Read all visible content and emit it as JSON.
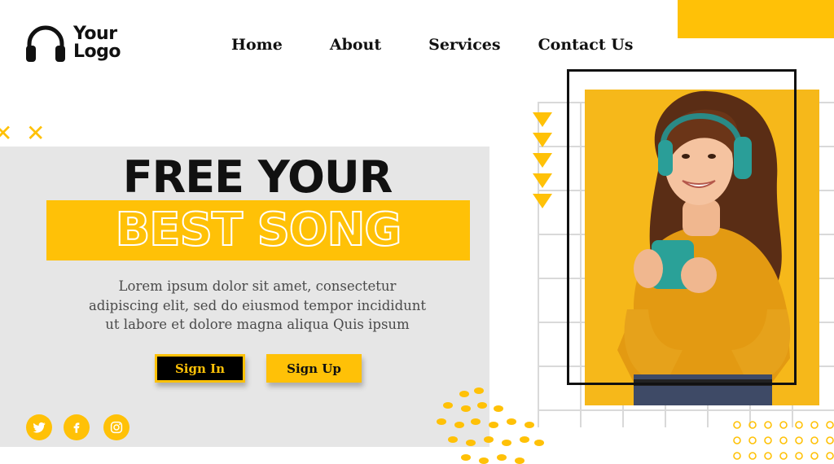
{
  "logo": {
    "line1": "Your",
    "line2": "Logo",
    "icon": "headphones-icon"
  },
  "nav": [
    {
      "label": "Home"
    },
    {
      "label": "About"
    },
    {
      "label": "Services"
    },
    {
      "label": "Contact Us"
    }
  ],
  "hero": {
    "headline_top": "FREE YOUR",
    "headline_bottom": "BEST SONG",
    "description_lines": [
      "Lorem ipsum dolor sit amet, consectetur",
      "adipiscing elit, sed do eiusmod tempor incididunt",
      "ut labore et dolore magna aliqua Quis ipsum"
    ],
    "sign_in": "Sign In",
    "sign_up": "Sign Up"
  },
  "social": [
    {
      "icon": "twitter-icon"
    },
    {
      "icon": "facebook-icon"
    },
    {
      "icon": "instagram-icon"
    }
  ],
  "colors": {
    "accent": "#ffc107",
    "dark": "#111111",
    "panel": "#e6e6e6"
  }
}
